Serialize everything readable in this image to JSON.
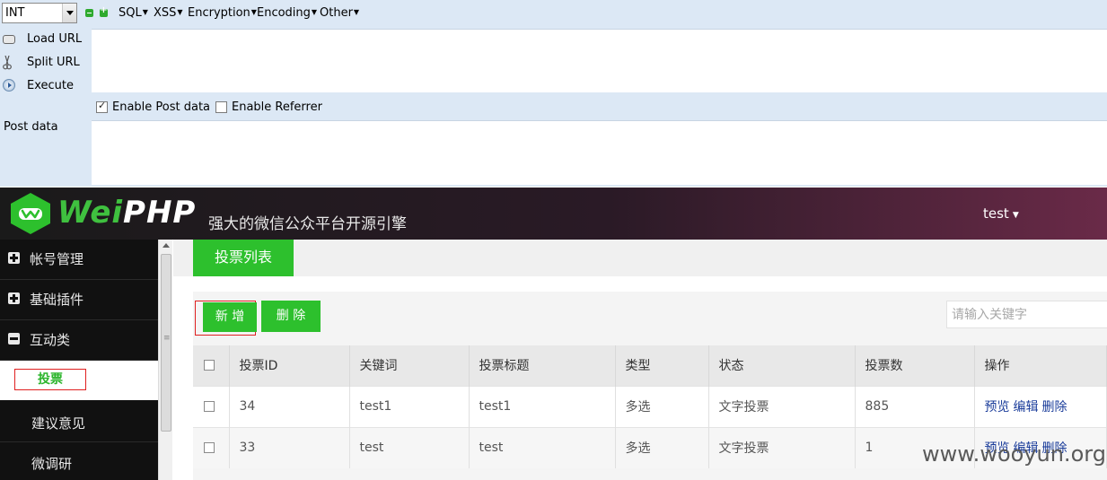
{
  "hackbar": {
    "select_value": "INT",
    "menus": [
      {
        "label": "SQL"
      },
      {
        "label": "XSS"
      },
      {
        "label": "Encryption"
      },
      {
        "label": "Encoding"
      },
      {
        "label": "Other"
      }
    ],
    "actions": {
      "load_url": "Load URL",
      "split_url": "Split URL",
      "execute": "Execute"
    },
    "url_value": "",
    "enable_post_label": "Enable Post data",
    "enable_post_checked": true,
    "enable_referrer_label": "Enable Referrer",
    "enable_referrer_checked": false,
    "post_data_label": "Post data",
    "post_data_value": ""
  },
  "header": {
    "logo_wei": "Wei",
    "logo_php": "PHP",
    "slogan": "强大的微信公众平台开源引擎",
    "user": "test",
    "brand_color": "#2dc02d"
  },
  "sidebar": {
    "groups": [
      {
        "label": "帐号管理",
        "icon": "plus-square-icon"
      },
      {
        "label": "基础插件",
        "icon": "plus-square-icon"
      },
      {
        "label": "互动类",
        "icon": "minus-square-icon"
      }
    ],
    "active_item": "投票",
    "sub_items": [
      {
        "label": "建议意见"
      },
      {
        "label": "微调研"
      }
    ]
  },
  "main": {
    "tab_label": "投票列表",
    "add_button": "新 增",
    "delete_button": "删 除",
    "search_placeholder": "请输入关键字",
    "table": {
      "headers": [
        "投票ID",
        "关键词",
        "投票标题",
        "类型",
        "状态",
        "投票数",
        "操作"
      ],
      "rows": [
        {
          "id": "34",
          "keyword": "test1",
          "title": "test1",
          "type": "多选",
          "status": "文字投票",
          "count": "885",
          "ops": [
            "预览",
            "编辑",
            "删除"
          ]
        },
        {
          "id": "33",
          "keyword": "test",
          "title": "test",
          "type": "多选",
          "status": "文字投票",
          "count": "1",
          "ops": [
            "预览",
            "编辑",
            "删除"
          ]
        }
      ]
    }
  },
  "watermark": "www.wooyun.org"
}
